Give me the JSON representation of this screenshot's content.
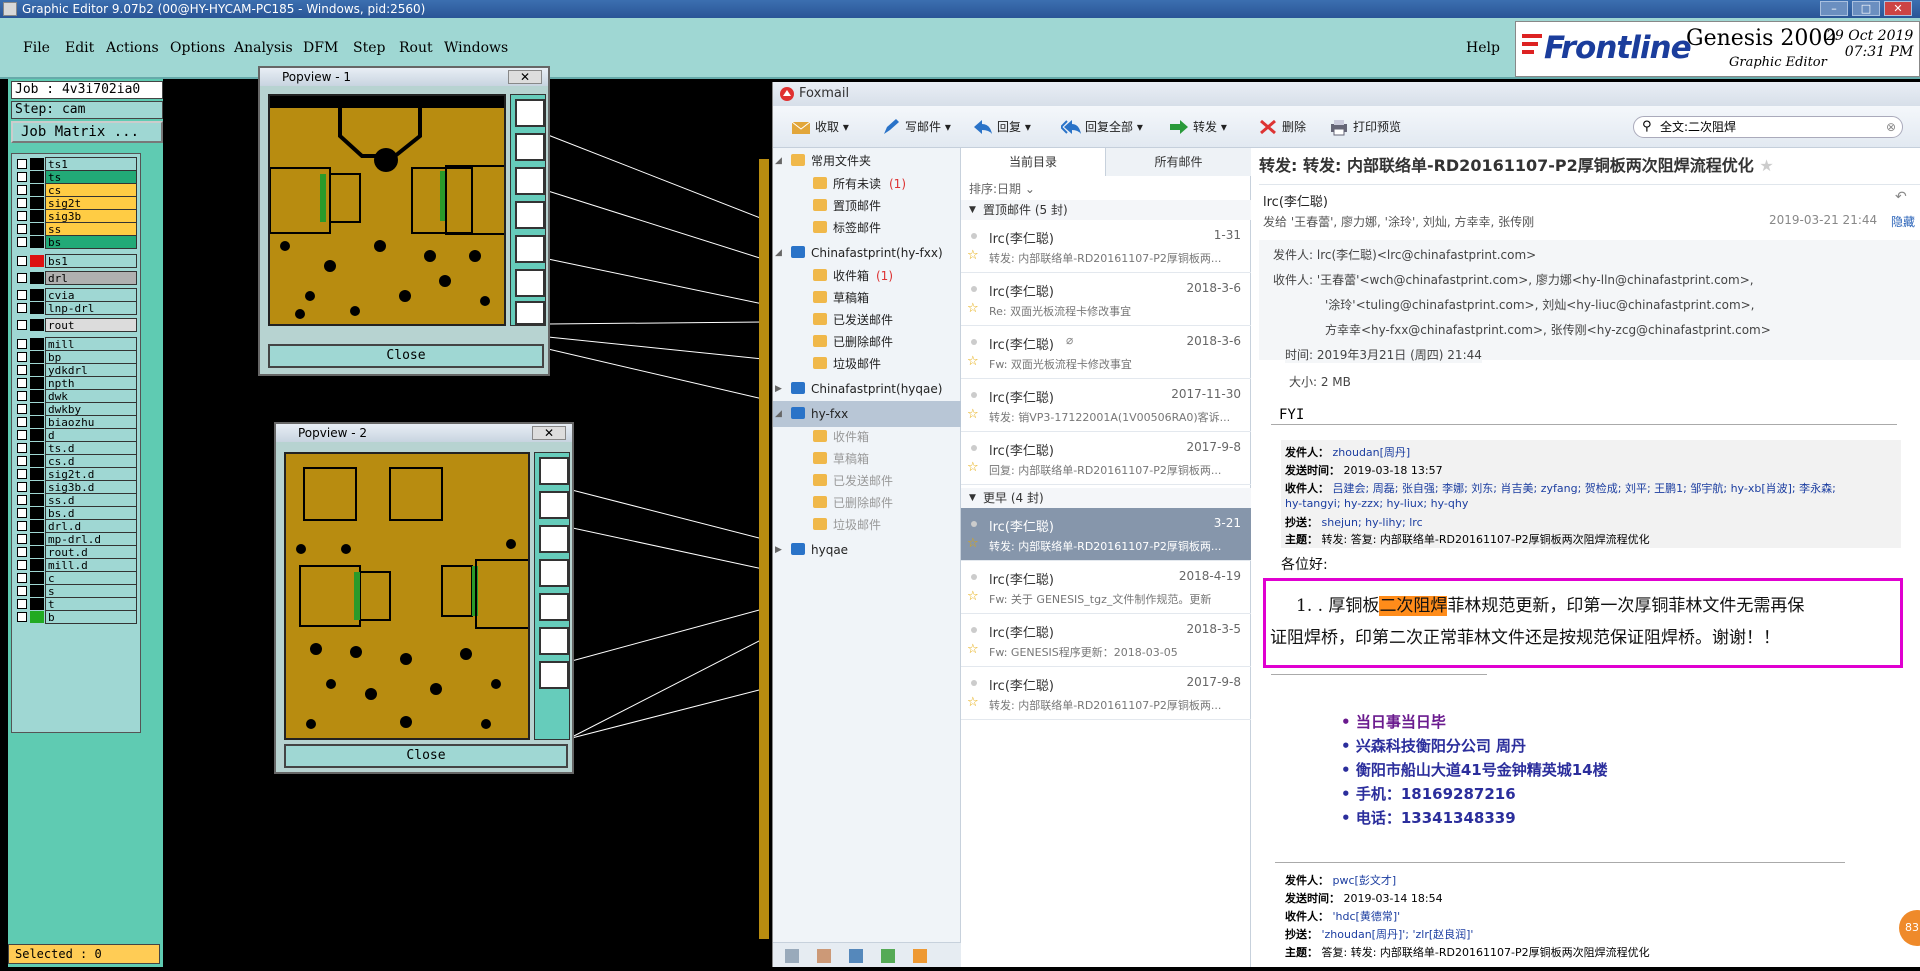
{
  "window": {
    "title": "Graphic Editor 9.07b2 (00@HY-HYCAM-PC185 - Windows, pid:2560)"
  },
  "menubar": {
    "items": [
      "File",
      "Edit",
      "Actions",
      "Options",
      "Analysis",
      "DFM",
      "Step",
      "Rout",
      "Windows"
    ],
    "help": "Help"
  },
  "brand": {
    "logo": "Frontline",
    "product": "Genesis 2000",
    "subtitle": "Graphic Editor",
    "date": "29 Oct 2019",
    "time": "07:31 PM"
  },
  "leftpanel": {
    "job": "Job : 4v3i702ia0",
    "step": "Step: cam",
    "job_matrix": "Job Matrix ...",
    "layers": [
      {
        "name": "ts1",
        "sw": "#000000",
        "bg": "#9fd7d3"
      },
      {
        "name": "ts",
        "sw": "#000000",
        "bg": "#22aa77"
      },
      {
        "name": "cs",
        "sw": "#000000",
        "bg": "#ffcc44"
      },
      {
        "name": "sig2t",
        "sw": "#000000",
        "bg": "#ffcc44"
      },
      {
        "name": "sig3b",
        "sw": "#000000",
        "bg": "#ffcc44"
      },
      {
        "name": "ss",
        "sw": "#000000",
        "bg": "#ffcc44"
      },
      {
        "name": "bs",
        "sw": "#000000",
        "bg": "#22aa77"
      },
      {
        "name": "bs1",
        "sw": "#dd1111",
        "bg": "#9fd7d3"
      },
      {
        "name": "drl",
        "sw": "#000000",
        "bg": "#b0b0b0"
      },
      {
        "name": "cvia",
        "sw": "#000000",
        "bg": "#9fd7d3"
      },
      {
        "name": "lnp-drl",
        "sw": "#000000",
        "bg": "#9fd7d3"
      },
      {
        "name": "rout",
        "sw": "#000000",
        "bg": "#dcdcdc"
      },
      {
        "name": "mill",
        "sw": "#000000",
        "bg": "#9fd7d3"
      },
      {
        "name": "bp",
        "sw": "#000000",
        "bg": "#9fd7d3"
      },
      {
        "name": "ydkdrl",
        "sw": "#000000",
        "bg": "#9fd7d3"
      },
      {
        "name": "npth",
        "sw": "#000000",
        "bg": "#9fd7d3"
      },
      {
        "name": "dwk",
        "sw": "#000000",
        "bg": "#9fd7d3"
      },
      {
        "name": "dwkby",
        "sw": "#000000",
        "bg": "#9fd7d3"
      },
      {
        "name": "biaozhu",
        "sw": "#000000",
        "bg": "#9fd7d3"
      },
      {
        "name": "d",
        "sw": "#000000",
        "bg": "#9fd7d3"
      },
      {
        "name": "ts.d",
        "sw": "#000000",
        "bg": "#9fd7d3"
      },
      {
        "name": "cs.d",
        "sw": "#000000",
        "bg": "#9fd7d3"
      },
      {
        "name": "sig2t.d",
        "sw": "#000000",
        "bg": "#9fd7d3"
      },
      {
        "name": "sig3b.d",
        "sw": "#000000",
        "bg": "#9fd7d3"
      },
      {
        "name": "ss.d",
        "sw": "#000000",
        "bg": "#9fd7d3"
      },
      {
        "name": "bs.d",
        "sw": "#000000",
        "bg": "#9fd7d3"
      },
      {
        "name": "drl.d",
        "sw": "#000000",
        "bg": "#9fd7d3"
      },
      {
        "name": "mp-drl.d",
        "sw": "#000000",
        "bg": "#9fd7d3"
      },
      {
        "name": "rout.d",
        "sw": "#000000",
        "bg": "#9fd7d3"
      },
      {
        "name": "mill.d",
        "sw": "#000000",
        "bg": "#9fd7d3"
      },
      {
        "name": "c",
        "sw": "#000000",
        "bg": "#9fd7d3"
      },
      {
        "name": "s",
        "sw": "#000000",
        "bg": "#9fd7d3"
      },
      {
        "name": "t",
        "sw": "#000000",
        "bg": "#9fd7d3"
      },
      {
        "name": "b",
        "sw": "#22aa22",
        "bg": "#9fd7d3"
      }
    ],
    "selected": "Selected : 0"
  },
  "popview1": {
    "title": "Popview - 1",
    "close": "Close"
  },
  "popview2": {
    "title": "Popview - 2",
    "close": "Close"
  },
  "foxmail": {
    "title": "Foxmail",
    "toolbar": [
      "收取",
      "写邮件",
      "回复",
      "回复全部",
      "转发",
      "删除",
      "打印预览"
    ],
    "search": "全文:二次阻焊",
    "tree": [
      {
        "label": "常用文件夹",
        "level": 0
      },
      {
        "label": "所有未读",
        "count": "(1)",
        "level": 1
      },
      {
        "label": "置顶邮件",
        "level": 1
      },
      {
        "label": "标签邮件",
        "level": 1
      },
      {
        "label": "Chinafastprint(hy-fxx)",
        "level": 0
      },
      {
        "label": "收件箱",
        "count": "(1)",
        "level": 1
      },
      {
        "label": "草稿箱",
        "level": 1
      },
      {
        "label": "已发送邮件",
        "level": 1
      },
      {
        "label": "已删除邮件",
        "level": 1
      },
      {
        "label": "垃圾邮件",
        "level": 1
      },
      {
        "label": "Chinafastprint(hyqae)",
        "level": 0
      },
      {
        "label": "hy-fxx",
        "level": 0
      },
      {
        "label": "收件箱",
        "level": 1
      },
      {
        "label": "草稿箱",
        "level": 1
      },
      {
        "label": "已发送邮件",
        "level": 1
      },
      {
        "label": "已删除邮件",
        "level": 1
      },
      {
        "label": "垃圾邮件",
        "level": 1
      },
      {
        "label": "hyqae",
        "level": 0
      }
    ],
    "list": {
      "tabs": [
        "当前目录",
        "所有邮件"
      ],
      "sort": "排序:日期",
      "group1": "置顶邮件 (5 封)",
      "group2": "更早 (4 封)",
      "items": [
        {
          "from": "lrc(李仁聪)",
          "date": "1-31",
          "subject": "转发: 内部联络单-RD20161107-P2厚铜板两..."
        },
        {
          "from": "lrc(李仁聪)",
          "date": "2018-3-6",
          "subject": "Re: 双面光板流程卡修改事宜"
        },
        {
          "from": "lrc(李仁聪)",
          "date": "2018-3-6",
          "subject": "Fw: 双面光板流程卡修改事宜"
        },
        {
          "from": "lrc(李仁聪)",
          "date": "2017-11-30",
          "subject": "转发: 销VP3-17122001A(1V00506RA0)客诉..."
        },
        {
          "from": "lrc(李仁聪)",
          "date": "2017-9-8",
          "subject": "回复: 内部联络单-RD20161107-P2厚铜板两..."
        },
        {
          "from": "lrc(李仁聪)",
          "date": "3-21",
          "subject": "转发: 内部联络单-RD20161107-P2厚铜板两..."
        },
        {
          "from": "lrc(李仁聪)",
          "date": "2018-4-19",
          "subject": "Fw: 关于 GENESIS_tgz_文件制作规范。更新"
        },
        {
          "from": "lrc(李仁聪)",
          "date": "2018-3-5",
          "subject": "Fw: GENESIS程序更新：2018-03-05"
        },
        {
          "from": "lrc(李仁聪)",
          "date": "2017-9-8",
          "subject": "转发: 内部联络单-RD20161107-P2厚铜板两..."
        }
      ]
    },
    "reader": {
      "subject": "转发: 转发: 内部联络单-RD20161107-P2厚铜板两次阻焊流程优化",
      "sender": "lrc(李仁聪)",
      "to_line": "发给 '王春蕾', 廖力娜, '涂玲', 刘灿, 方幸幸, 张传刚",
      "datetime": "2019-03-21 21:44",
      "hide": "隐藏",
      "from_label": "发件人: lrc(李仁聪)<lrc@chinafastprint.com>",
      "to1": "收件人: '王春蕾'<wch@chinafastprint.com>,  廖力娜<hy-lln@chinafastprint.com>,",
      "to2": "'涂玲'<tuling@chinafastprint.com>,  刘灿<hy-liuc@chinafastprint.com>,",
      "to3": "方幸幸<hy-fxx@chinafastprint.com>,  张传刚<hy-zcg@chinafastprint.com>",
      "time": "时间: 2019年3月21日 (周四) 21:44",
      "size": "大小: 2 MB",
      "fyi": "FYI",
      "q1_from_k": "发件人：",
      "q1_from_v": "zhoudan[周丹]",
      "q1_time_k": "发送时间：",
      "q1_time_v": "2019-03-18 13:57",
      "q1_to_k": "收件人：",
      "q1_to_v": "吕建会; 周磊; 张自强; 李娜; 刘东; 肖吉美; zyfang; 贺检成; 刘平; 王鹏1; 邹宇航; hy-xb[肖波]; 李永森;",
      "q1_to_v2": "hy-tangyi; hy-zzx; hy-liux; hy-qhy",
      "q1_cc_k": "抄送：",
      "q1_cc_v": "shejun; hy-lihy; lrc",
      "q1_subj_k": "主题：",
      "q1_subj_v": "转发: 答复: 内部联络单-RD20161107-P2厚铜板两次阻焊流程优化",
      "greet": "各位好:",
      "body_pre": "1. . 厚铜板",
      "body_hl": "二次阻焊",
      "body_post": "菲林规范更新，印第一次厚铜菲林文件无需再保",
      "body_line2": "证阻焊桥，印第二次正常菲林文件还是按规范保证阻焊桥。谢谢！！",
      "sig": [
        "当日事当日毕",
        "兴森科技衡阳分公司    周丹",
        "衡阳市船山大道41号金钟精英城14楼",
        "手机：18169287216",
        "电话：13341348339"
      ],
      "q2_from_k": "发件人：",
      "q2_from_v": "pwc[彭文才]",
      "q2_time_k": "发送时间：",
      "q2_time_v": "2019-03-14 18:54",
      "q2_to_k": "收件人：",
      "q2_to_v": "'hdc[黄德常]'",
      "q2_cc_k": "抄送：",
      "q2_cc_v": "'zhoudan[周丹]'; 'zlr[赵良润]'",
      "q2_subj_k": "主题：",
      "q2_subj_v": "答复: 转发: 内部联络单-RD20161107-P2厚铜板两次阻焊流程优化",
      "badge": "83"
    }
  }
}
